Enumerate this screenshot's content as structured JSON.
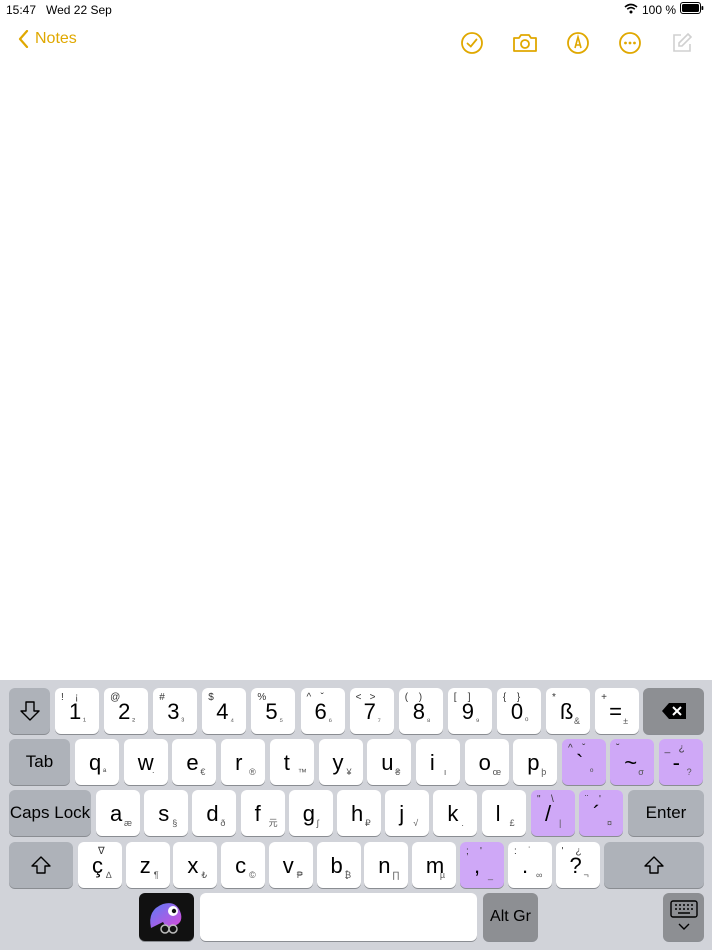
{
  "status": {
    "time": "15:47",
    "date": "Wed 22 Sep",
    "battery": "100 %"
  },
  "nav": {
    "back_label": "Notes"
  },
  "colors": {
    "accent": "#e0a800",
    "keyboard_bg": "#d1d3d9",
    "key_purple": "#cfa8f7"
  },
  "keyboard": {
    "row1": [
      {
        "main": "1",
        "tl": "!",
        "tr": "¡",
        "br": "¹"
      },
      {
        "main": "2",
        "tl": "@",
        "tr": "",
        "br": "²"
      },
      {
        "main": "3",
        "tl": "#",
        "tr": "",
        "br": "³"
      },
      {
        "main": "4",
        "tl": "$",
        "tr": "",
        "br": "⁴"
      },
      {
        "main": "5",
        "tl": "%",
        "tr": "",
        "br": "⁵"
      },
      {
        "main": "6",
        "tl": "^",
        "tr": "ˇ",
        "br": "⁶"
      },
      {
        "main": "7",
        "tl": "<",
        "tr": ">",
        "br": "⁷"
      },
      {
        "main": "8",
        "tl": "(",
        "tr": ")",
        "br": "⁸"
      },
      {
        "main": "9",
        "tl": "[",
        "tr": "]",
        "br": "⁹"
      },
      {
        "main": "0",
        "tl": "{",
        "tr": "}",
        "br": "⁰"
      },
      {
        "main": "ß",
        "tl": "*",
        "tr": "",
        "br": "&"
      },
      {
        "main": "=",
        "tl": "+",
        "tr": "",
        "br": "±"
      }
    ],
    "row2": [
      {
        "main": "q",
        "br": "ª"
      },
      {
        "main": "w",
        "br": "·"
      },
      {
        "main": "e",
        "br": "€"
      },
      {
        "main": "r",
        "br": "®"
      },
      {
        "main": "t",
        "br": "™"
      },
      {
        "main": "y",
        "br": "¥"
      },
      {
        "main": "u",
        "br": "₴"
      },
      {
        "main": "i",
        "br": "ı"
      },
      {
        "main": "o",
        "br": "œ"
      },
      {
        "main": "p",
        "br": "þ"
      }
    ],
    "row2_purple": [
      {
        "main": "`",
        "tl": "^",
        "tr": "ˇ",
        "br": "º"
      },
      {
        "main": "~",
        "tl": "˘",
        "tr": "",
        "br": "σ"
      },
      {
        "main": "-",
        "tl": "_",
        "tr": "¿",
        "br": "?"
      }
    ],
    "row3": [
      {
        "main": "a",
        "br": "æ"
      },
      {
        "main": "s",
        "br": "§"
      },
      {
        "main": "d",
        "br": "ð"
      },
      {
        "main": "f",
        "br": "元"
      },
      {
        "main": "g",
        "br": "ʃ"
      },
      {
        "main": "h",
        "br": "₽"
      },
      {
        "main": "j",
        "br": "√"
      },
      {
        "main": "k",
        "br": "."
      },
      {
        "main": "l",
        "br": "£"
      }
    ],
    "row3_purple": [
      {
        "main": "/",
        "tl": "\"",
        "tr": "\\",
        "br": "|"
      },
      {
        "main": "´",
        "tl": "¨",
        "tr": "'",
        "br": "¤"
      }
    ],
    "row4": [
      {
        "main": "ç",
        "tl": "",
        "tr": "∇",
        "br": "∆"
      },
      {
        "main": "z",
        "br": "¶"
      },
      {
        "main": "x",
        "br": "₺"
      },
      {
        "main": "c",
        "br": "©"
      },
      {
        "main": "v",
        "br": "₱"
      },
      {
        "main": "b",
        "br": "₿"
      },
      {
        "main": "n",
        "br": "∏"
      },
      {
        "main": "m",
        "br": "µ"
      }
    ],
    "row4_purple": [
      {
        "main": ",",
        "tl": ";",
        "tr": "'",
        "br": "_"
      }
    ],
    "row4_tail": [
      {
        "main": ".",
        "tl": ":",
        "tr": "˙",
        "br": "∞"
      },
      {
        "main": "?",
        "tl": "'",
        "tr": "¿",
        "br": "¬"
      }
    ],
    "labels": {
      "tab": "Tab",
      "caps": "Caps Lock",
      "enter": "Enter",
      "altgr": "Alt Gr"
    }
  }
}
